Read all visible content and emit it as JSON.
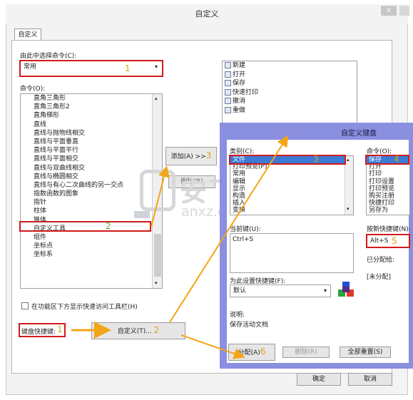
{
  "window": {
    "title": "自定义",
    "close_glyph": "x"
  },
  "tab": {
    "label": "自定义"
  },
  "choose_commands_label": "由此中选择命令(C):",
  "choose_commands_value": "常用",
  "commands_label": "命令(O):",
  "commands": [
    "直角三角形",
    "直角三角形2",
    "直角梯形",
    "直线",
    "直线与抛物线相交",
    "直线与平面垂直",
    "直线与平面平行",
    "直线与平面相交",
    "直线与双曲线相交",
    "直线与椭圆相交",
    "直线与有心二次曲线的另一交点",
    "指数函数的图象",
    "指针",
    "柱体",
    "锥体",
    "自定义工具",
    "组件",
    "坐标点",
    "坐标系"
  ],
  "add_button": "添加(A) >>",
  "remove_button": "删除(R)",
  "right_list": [
    "新建",
    "打开",
    "保存",
    "快速打印",
    "撤消",
    "重做"
  ],
  "show_qat_checkbox": "在功能区下方显示快速访问工具栏(H)",
  "keyboard_shortcut_label": "键盘快捷键:",
  "customize_button": "自定义(T)...",
  "ok_button": "确定",
  "cancel_button": "取消",
  "numbers": {
    "n1a": "1",
    "n1b": "1",
    "n2a": "2",
    "n2b": "2",
    "n3a": "3",
    "n3b": "3",
    "n4": "4",
    "n5": "5",
    "n6": "6"
  },
  "kb_dialog": {
    "title": "自定义键盘",
    "category_label": "类别(C):",
    "categories": [
      "文件",
      "打印预览(P)",
      "常用",
      "编辑",
      "显示",
      "构造",
      "插入",
      "变换"
    ],
    "command_label": "命令(O):",
    "commands": [
      "保存",
      "打开",
      "打印",
      "打印设置",
      "打印预览",
      "购买注册",
      "快捷打印",
      "另存为"
    ],
    "current_keys_label": "当前键(U):",
    "current_key": "Ctrl+S",
    "new_key_label": "按新快捷键(N):",
    "new_key_value": "Alt+S",
    "assigned_to_label": "已分配给:",
    "assigned_to_value": "[未分配]",
    "save_changes_label": "为此设置快捷键(F):",
    "save_changes_value": "默认",
    "description_label": "说明:",
    "description_value": "保存活动文档",
    "assign_button": "分配(A)",
    "remove_button": "删除(R)",
    "reset_all_button": "全部重置(S)"
  },
  "watermark": {
    "cn": "安下载",
    "en": "anxz.com"
  },
  "colors": {
    "red": "#d11b1b",
    "arrow": "#f2a516",
    "dialog_frame": "#8a8fe0",
    "selection": "#3b7bd6"
  }
}
